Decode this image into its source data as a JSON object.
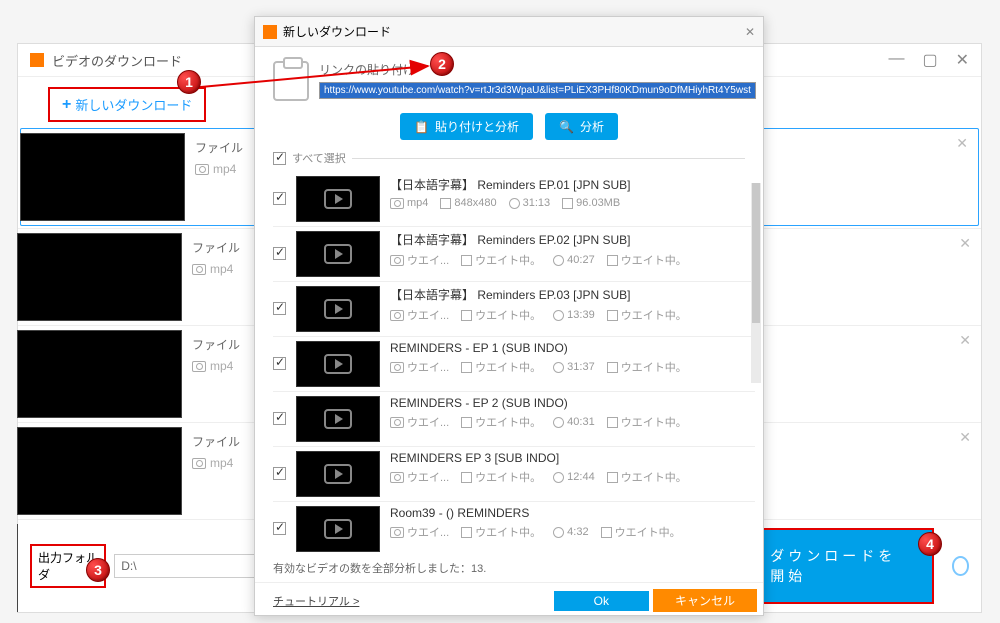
{
  "bg_window": {
    "title": "ビデオのダウンロード",
    "new_download": "新しいダウンロード",
    "file_label": "ファイル",
    "format": "mp4",
    "output_folder_label": "出力フォルダ",
    "output_folder_value": "D:\\",
    "start_download": "ダウンロードを開始"
  },
  "dialog": {
    "title": "新しいダウンロード",
    "paste_label": "リンクの貼り付け",
    "url": "https://www.youtube.com/watch?v=rtJr3d3WpaU&list=PLiEX3PHf80KDmun9oDfMHiyhRt4Y5wst",
    "paste_analyze_btn": "貼り付けと分析",
    "analyze_btn": "分析",
    "select_all": "すべて選択",
    "status": "有効なビデオの数を全部分析しました：13.",
    "tutorial": "チュートリアル >",
    "ok": "Ok",
    "cancel": "キャンセル",
    "wait_short": "ウエイ...",
    "wait_full": "ウエイト中。",
    "videos": [
      {
        "title": "【日本語字幕】 Reminders  EP.01 [JPN SUB]",
        "fmt": "mp4",
        "res": "848x480",
        "dur": "31:13",
        "size": "96.03MB"
      },
      {
        "title": "【日本語字幕】 Reminders  EP.02 [JPN SUB]",
        "fmt": "ウエイ...",
        "res": "ウエイト中。",
        "dur": "40:27",
        "size": "ウエイト中。"
      },
      {
        "title": "【日本語字幕】 Reminders  EP.03 [JPN SUB]",
        "fmt": "ウエイ...",
        "res": "ウエイト中。",
        "dur": "13:39",
        "size": "ウエイト中。"
      },
      {
        "title": "REMINDERS - EP 1 (SUB INDO)",
        "fmt": "ウエイ...",
        "res": "ウエイト中。",
        "dur": "31:37",
        "size": "ウエイト中。"
      },
      {
        "title": "REMINDERS - EP 2 (SUB INDO)",
        "fmt": "ウエイ...",
        "res": "ウエイト中。",
        "dur": "40:31",
        "size": "ウエイト中。"
      },
      {
        "title": "REMINDERS EP 3 [SUB INDO]",
        "fmt": "ウエイ...",
        "res": "ウエイト中。",
        "dur": "12:44",
        "size": "ウエイト中。"
      },
      {
        "title": "Room39 -  () REMINDERS",
        "fmt": "ウエイ...",
        "res": "ウエイト中。",
        "dur": "4:32",
        "size": "ウエイト中。"
      }
    ]
  },
  "badges": {
    "b1": "1",
    "b2": "2",
    "b3": "3",
    "b4": "4"
  }
}
